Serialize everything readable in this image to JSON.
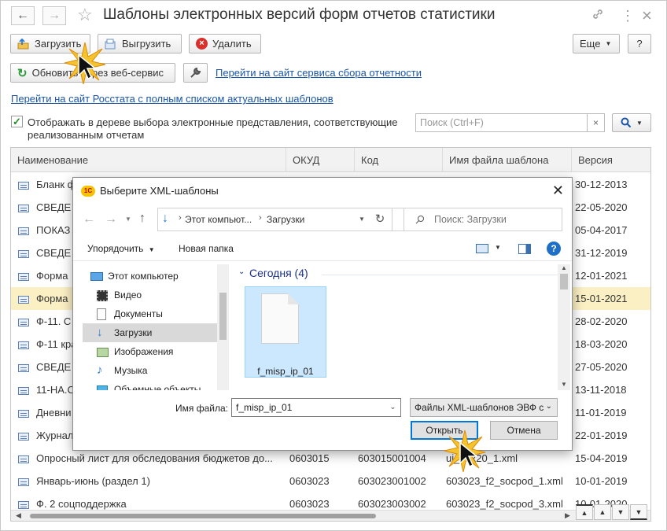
{
  "window": {
    "title": "Шаблоны электронных версий форм отчетов статистики",
    "nav_back": "←",
    "nav_forward": "→",
    "star": "☆",
    "link_icon": "🔗",
    "more_icon": "⋮",
    "close_icon": "×"
  },
  "toolbar": {
    "load_label": "Загрузить",
    "unload_label": "Выгрузить",
    "delete_label": "Удалить",
    "more_label": "Еще",
    "help_label": "?",
    "refresh_label": "Обновить через веб-сервис",
    "service_link": "Перейти на сайт сервиса сбора отчетности",
    "rosstat_link": "Перейти на сайт Росстата с полным списком актуальных шаблонов"
  },
  "filter": {
    "checkbox_label": "Отображать в дереве выбора электронные представления, соответствующие реализованным отчетам",
    "checked": true,
    "search_placeholder": "Поиск (Ctrl+F)"
  },
  "table": {
    "columns": [
      "Наименование",
      "ОКУД",
      "Код",
      "Имя файла шаблона",
      "Версия"
    ],
    "rows": [
      {
        "name": "Бланк ф",
        "okud": "",
        "code": "",
        "file": "",
        "version": "30-12-2013"
      },
      {
        "name": "СВЕДЕ",
        "okud": "",
        "code": "",
        "file": "",
        "version": "22-05-2020"
      },
      {
        "name": "ПОКАЗ",
        "okud": "",
        "code": "",
        "file": "",
        "version": "05-04-2017"
      },
      {
        "name": "СВЕДЕ",
        "okud": "",
        "code": "",
        "file": "",
        "version": "31-12-2019"
      },
      {
        "name": "Форма",
        "okud": "",
        "code": "",
        "file": "",
        "version": "12-01-2021"
      },
      {
        "name": "Форма",
        "okud": "",
        "code": "",
        "file": "",
        "version": "15-01-2021"
      },
      {
        "name": "Ф-11. С",
        "okud": "",
        "code": "",
        "file": "",
        "version": "28-02-2020"
      },
      {
        "name": "Ф-11 кра",
        "okud": "",
        "code": "",
        "file": "",
        "version": "18-03-2020"
      },
      {
        "name": "СВЕДЕ",
        "okud": "",
        "code": "",
        "file": "",
        "version": "27-05-2020"
      },
      {
        "name": "11-НА.С",
        "okud": "",
        "code": "",
        "file": "",
        "version": "13-11-2018"
      },
      {
        "name": "Дневни",
        "okud": "",
        "code": "",
        "file": "",
        "version": "11-01-2019"
      },
      {
        "name": "Журнал",
        "okud": "",
        "code": "",
        "file": "",
        "version": "22-01-2019"
      },
      {
        "name": "Опросный лист для обследования бюджетов до...",
        "okud": "0603015",
        "code": "603015001004",
        "file": "uj_bdx20_1.xml",
        "version": "15-04-2019"
      },
      {
        "name": "Январь-июнь (раздел 1)",
        "okud": "0603023",
        "code": "603023001002",
        "file": "603023_f2_socpod_1.xml",
        "version": "10-01-2019"
      },
      {
        "name": "Ф. 2 соцподдержка",
        "okud": "0603023",
        "code": "603023003002",
        "file": "603023_f2_socpod_3.xml",
        "version": "10-01-2020"
      }
    ],
    "selected_row": 5,
    "scroll_buttons": [
      "▲",
      "▲",
      "▼",
      "▼"
    ]
  },
  "dialog": {
    "title": "Выберите XML-шаблоны",
    "logo_text": "1С",
    "close": "✕",
    "address": [
      "Этот компьют...",
      "Загрузки"
    ],
    "search_placeholder": "Поиск: Загрузки",
    "organize_label": "Упорядочить",
    "new_folder_label": "Новая папка",
    "help": "?",
    "tree": [
      {
        "label": "Этот компьютер",
        "icon": "computer-icon"
      },
      {
        "label": "Видео",
        "icon": "video-icon"
      },
      {
        "label": "Документы",
        "icon": "documents-icon"
      },
      {
        "label": "Загрузки",
        "icon": "downloads-icon",
        "selected": true
      },
      {
        "label": "Изображения",
        "icon": "images-icon"
      },
      {
        "label": "Музыка",
        "icon": "music-icon"
      },
      {
        "label": "Объемные объекты",
        "icon": "3d-objects-icon"
      }
    ],
    "group_label": "Сегодня (4)",
    "file_name": "f_misp_ip_01",
    "filename_label": "Имя файла:",
    "filename_value": "f_misp_ip_01",
    "filetype_value": "Файлы XML-шаблонов ЭВФ с",
    "open_label": "Открыть",
    "cancel_label": "Отмена"
  },
  "colors": {
    "selected_row": "#fbf0c4",
    "link": "#1a55a8",
    "accent_blue": "#0078d7",
    "tile_selected": "#cce8ff"
  }
}
